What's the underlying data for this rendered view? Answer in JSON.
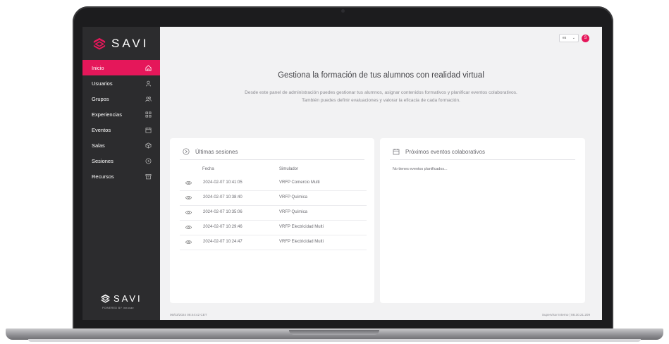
{
  "brand": {
    "name": "SAVI",
    "powered_by": "POWERED BY  innovae"
  },
  "sidebar": {
    "items": [
      {
        "label": "Inicio",
        "icon": "home-icon",
        "active": true
      },
      {
        "label": "Usuarios",
        "icon": "user-icon",
        "active": false
      },
      {
        "label": "Grupos",
        "icon": "group-icon",
        "active": false
      },
      {
        "label": "Experiencias",
        "icon": "grid-icon",
        "active": false
      },
      {
        "label": "Eventos",
        "icon": "calendar-icon",
        "active": false
      },
      {
        "label": "Salas",
        "icon": "cube-icon",
        "active": false
      },
      {
        "label": "Sesiones",
        "icon": "play-circle-icon",
        "active": false
      },
      {
        "label": "Recursos",
        "icon": "archive-icon",
        "active": false
      }
    ]
  },
  "header": {
    "language": "es",
    "avatar_initial": "S"
  },
  "hero": {
    "title": "Gestiona la formación de tus alumnos con realidad virtual",
    "subtitle_line1": "Desde este panel de administración puedes gestionar tus alumnos, asignar contenidos formativos y planificar eventos colaborativos.",
    "subtitle_line2": "También puedes definir evaluaciones y valorar la eficacia de cada formación."
  },
  "sessions": {
    "title": "Últimas sesiones",
    "columns": [
      "Fecha",
      "Simulador"
    ],
    "rows": [
      {
        "fecha": "2024-02-07 10:41:05",
        "simulador": "VRFP Comercio Multi"
      },
      {
        "fecha": "2024-02-07 10:38:40",
        "simulador": "VRFP Química"
      },
      {
        "fecha": "2024-02-07 10:35:06",
        "simulador": "VRFP Química"
      },
      {
        "fecha": "2024-02-07 10:29:46",
        "simulador": "VRFP Electricidad Multi"
      },
      {
        "fecha": "2024-02-07 10:24:47",
        "simulador": "VRFP Electricidad Multi"
      }
    ]
  },
  "events": {
    "title": "Próximos eventos colaborativos",
    "empty_text": "No tienes eventos planificados..."
  },
  "status": {
    "timestamp": "06/03/2024 08:44:42 CET",
    "user_info": "Supervisor Interno | 88.30.21.209"
  },
  "colors": {
    "accent": "#e5175a",
    "sidebar": "#2c2c2e",
    "background": "#f2f2f3"
  }
}
